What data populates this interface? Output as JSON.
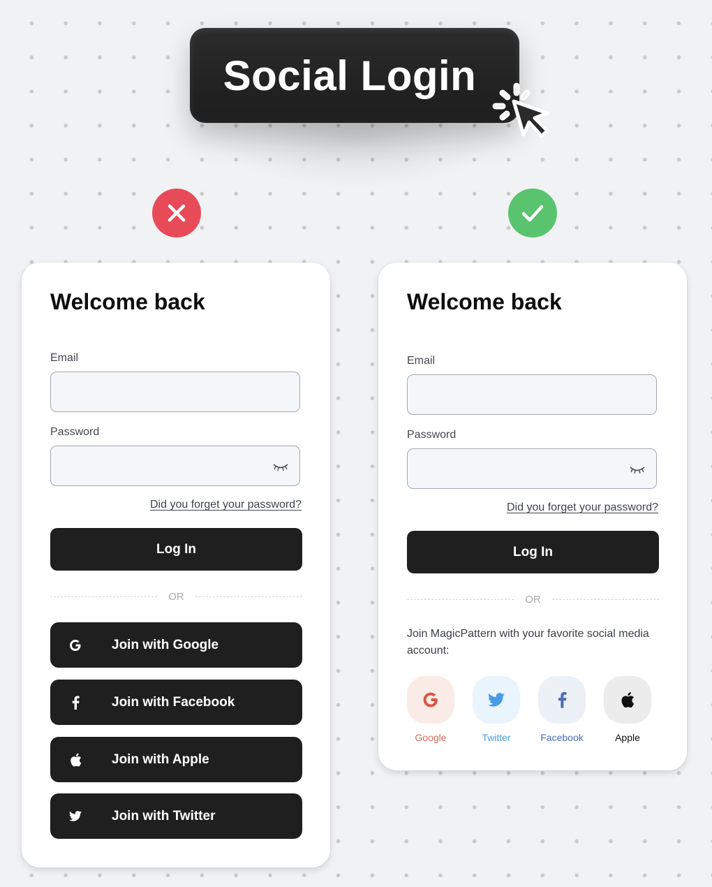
{
  "hero": {
    "title": "Social Login",
    "cursor_icon": "mouse-pointer-click"
  },
  "comparison": {
    "bad_icon": "x-icon",
    "good_icon": "check-icon",
    "bad_color": "#e84b58",
    "good_color": "#59c36d"
  },
  "bad_example": {
    "title": "Welcome back",
    "email_label": "Email",
    "email_value": "",
    "password_label": "Password",
    "password_value": "",
    "password_toggle_icon": "eye-closed",
    "forgot_link": "Did you forget your password?",
    "login_button": "Log In",
    "divider_text": "OR",
    "social_buttons": [
      {
        "icon": "google",
        "label": "Join with Google"
      },
      {
        "icon": "facebook",
        "label": "Join with Facebook"
      },
      {
        "icon": "apple",
        "label": "Join with Apple"
      },
      {
        "icon": "twitter",
        "label": "Join with Twitter"
      }
    ]
  },
  "good_example": {
    "title": "Welcome back",
    "email_label": "Email",
    "email_value": "",
    "password_label": "Password",
    "password_value": "",
    "password_toggle_icon": "eye-closed",
    "forgot_link": "Did you forget your password?",
    "login_button": "Log In",
    "divider_text": "OR",
    "social_prompt": "Join MagicPattern with your favorite social media account:",
    "social_tiles": [
      {
        "icon": "google",
        "label": "Google",
        "color": "#d9553e",
        "bg": "#fbebe7"
      },
      {
        "icon": "twitter",
        "label": "Twitter",
        "color": "#4a9be6",
        "bg": "#e9f4fd"
      },
      {
        "icon": "facebook",
        "label": "Facebook",
        "color": "#4a6cb6",
        "bg": "#ecf0f7"
      },
      {
        "icon": "apple",
        "label": "Apple",
        "color": "#111111",
        "bg": "#ececec"
      }
    ]
  }
}
